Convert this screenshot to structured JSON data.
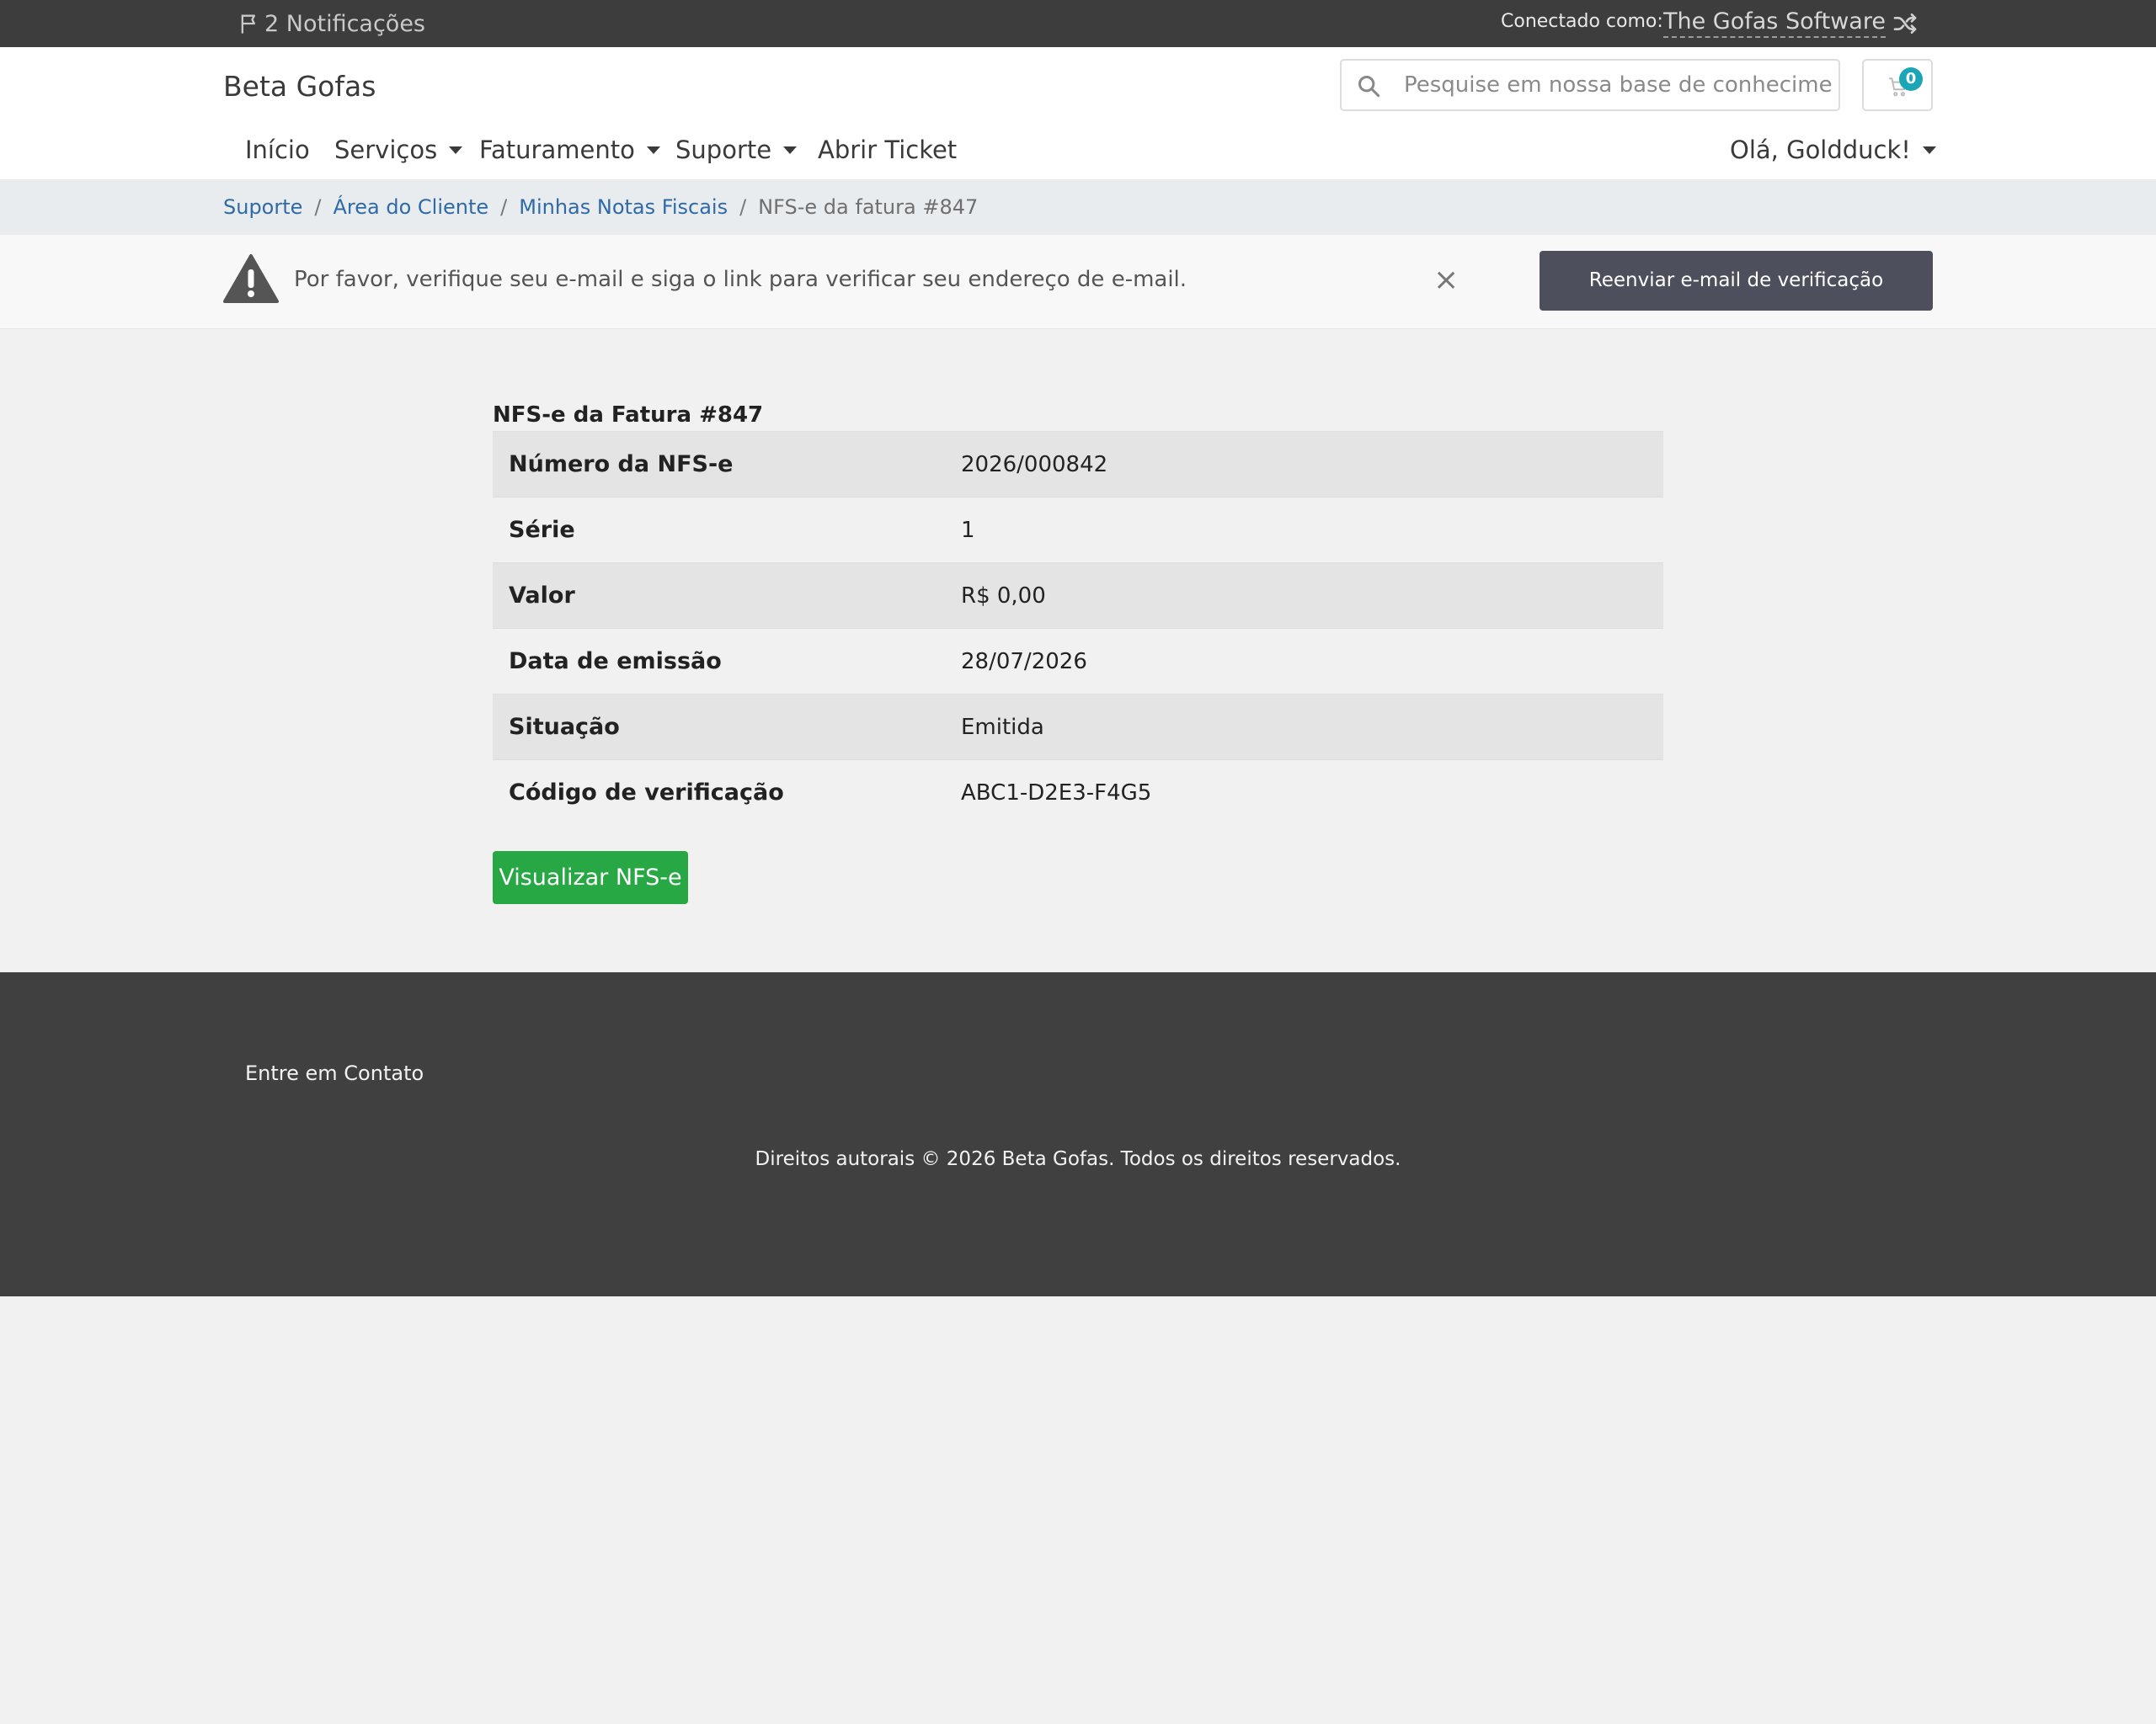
{
  "topbar": {
    "notifications": "2 Notificações",
    "connected_label": "Conectado como:",
    "connected_value": "The Gofas Software"
  },
  "header": {
    "brand": "Beta Gofas",
    "search_placeholder": "Pesquise em nossa base de conhecimento",
    "cart_count": "0"
  },
  "nav": {
    "items": [
      {
        "label": "Início"
      },
      {
        "label": "Serviços"
      },
      {
        "label": "Faturamento"
      },
      {
        "label": "Suporte"
      },
      {
        "label": "Abrir Ticket"
      }
    ],
    "user": "Olá, Goldduck!"
  },
  "breadcrumb": [
    "Suporte",
    "Área do Cliente",
    "Minhas Notas Fiscais",
    "NFS-e da fatura #847"
  ],
  "alert": {
    "message": "Por favor, verifique seu e-mail e siga o link para verificar seu endereço de e-mail.",
    "close": "×",
    "resend_button": "Reenviar e-mail de verificação"
  },
  "invoice": {
    "title": "NFS-e da Fatura #847",
    "rows": [
      {
        "label": "Número da NFS-e",
        "value": "2026/000842"
      },
      {
        "label": "Série",
        "value": "1"
      },
      {
        "label": "Valor",
        "value": "R$ 0,00"
      },
      {
        "label": "Data de emissão",
        "value": "28/07/2026"
      },
      {
        "label": "Situação",
        "value": "Emitida"
      },
      {
        "label": "Código de verificação",
        "value": "ABC1-D2E3-F4G5"
      }
    ],
    "view_button": "Visualizar NFS-e"
  },
  "footer": {
    "contact": "Entre em Contato",
    "copyright": "Direitos autorais © 2026 Beta Gofas. Todos os direitos reservados."
  },
  "colors": {
    "topbar": "#3d3d3d",
    "link": "#2f6aa8",
    "success": "#28a745",
    "badge": "#1aa6b7",
    "resend": "#4d4f5c",
    "footer": "#404040"
  }
}
